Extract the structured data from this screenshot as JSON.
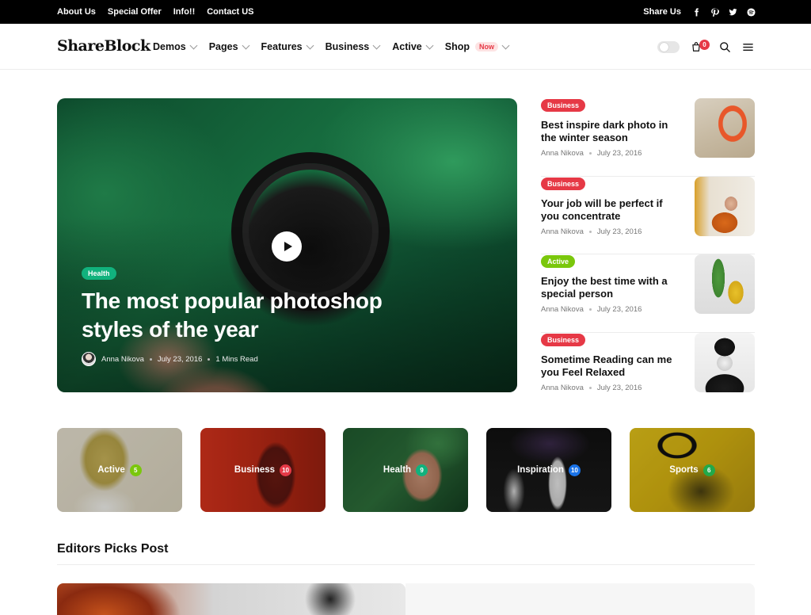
{
  "topbar": {
    "links": [
      "About Us",
      "Special Offer",
      "Info!!",
      "Contact US"
    ],
    "share_label": "Share Us",
    "social_icons": [
      "facebook-icon",
      "pinterest-icon",
      "twitter-icon",
      "spotify-icon"
    ]
  },
  "header": {
    "logo": "ShareBlock",
    "nav": [
      {
        "label": "Demos"
      },
      {
        "label": "Pages"
      },
      {
        "label": "Features"
      },
      {
        "label": "Business"
      },
      {
        "label": "Active"
      },
      {
        "label": "Shop",
        "badge": "Now"
      }
    ],
    "cart_count": "0"
  },
  "hero": {
    "tag": "Health",
    "title": "The most popular photoshop styles of the year",
    "author": "Anna Nikova",
    "date": "July 23, 2016",
    "read_time": "1 Mins Read",
    "tag_color": "#11b27d"
  },
  "side_posts": [
    {
      "tag": "Business",
      "tag_color": "#e63946",
      "title": "Best inspire dark photo in the winter season",
      "author": "Anna Nikova",
      "date": "July 23, 2016"
    },
    {
      "tag": "Business",
      "tag_color": "#e63946",
      "title": "Your job will be perfect if you concentrate",
      "author": "Anna Nikova",
      "date": "July 23, 2016"
    },
    {
      "tag": "Active",
      "tag_color": "#7ac70c",
      "title": "Enjoy the best time with a special person",
      "author": "Anna Nikova",
      "date": "July 23, 2016"
    },
    {
      "tag": "Business",
      "tag_color": "#e63946",
      "title": "Sometime Reading can me you Feel Relaxed",
      "author": "Anna Nikova",
      "date": "July 23, 2016"
    }
  ],
  "categories": [
    {
      "label": "Active",
      "count": "5",
      "count_color": "#7ac70c"
    },
    {
      "label": "Business",
      "count": "10",
      "count_color": "#e63946"
    },
    {
      "label": "Health",
      "count": "9",
      "count_color": "#11b27d"
    },
    {
      "label": "Inspiration",
      "count": "10",
      "count_color": "#1a73e8"
    },
    {
      "label": "Sports",
      "count": "6",
      "count_color": "#22a94a"
    }
  ],
  "editors": {
    "title": "Editors Picks Post"
  }
}
